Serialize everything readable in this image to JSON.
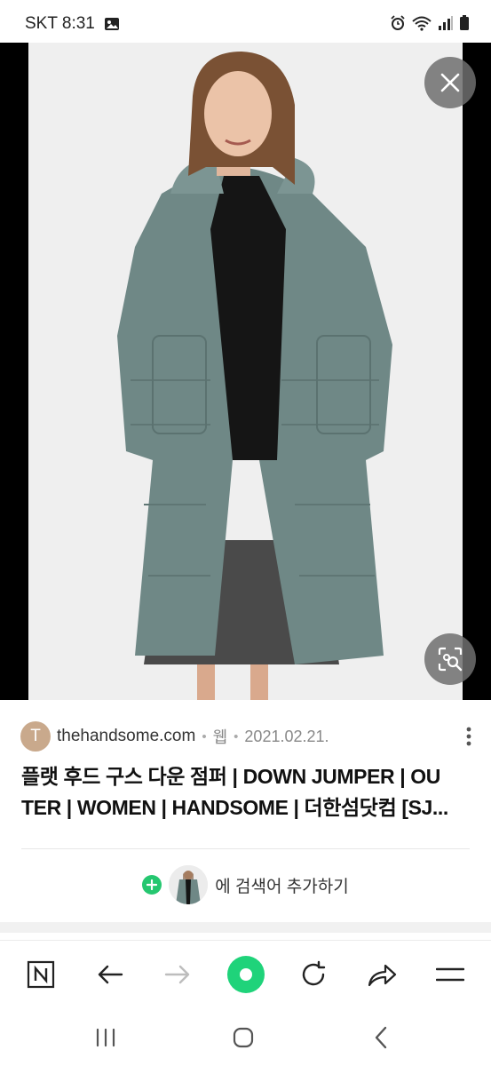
{
  "status_bar": {
    "carrier_time": "SKT 8:31",
    "icons": [
      "gallery-icon",
      "alarm-icon",
      "wifi-icon",
      "signal-icon",
      "battery-icon"
    ]
  },
  "viewer": {
    "close_icon": "close-icon",
    "lens_icon": "image-search-icon"
  },
  "result": {
    "favicon_letter": "T",
    "site": "thehandsome.com",
    "type": "웹",
    "date": "2021.02.21.",
    "title_line1": "플랫 후드 구스 다운 점퍼 | DOWN JUMPER | OU",
    "title_line2": "TER | WOMEN | HANDSOME | 더한섬닷컴 [SJ..."
  },
  "add_search": {
    "label": "에 검색어 추가하기"
  },
  "toolbar": {
    "items": [
      "naver-home-icon",
      "back-icon",
      "forward-icon",
      "green-dot-icon",
      "refresh-icon",
      "share-icon",
      "menu-icon"
    ]
  },
  "system_nav": {
    "items": [
      "recent-apps-icon",
      "home-icon",
      "back-icon"
    ]
  },
  "colors": {
    "accent_green": "#1fd37a",
    "coat": "#6f8886"
  }
}
